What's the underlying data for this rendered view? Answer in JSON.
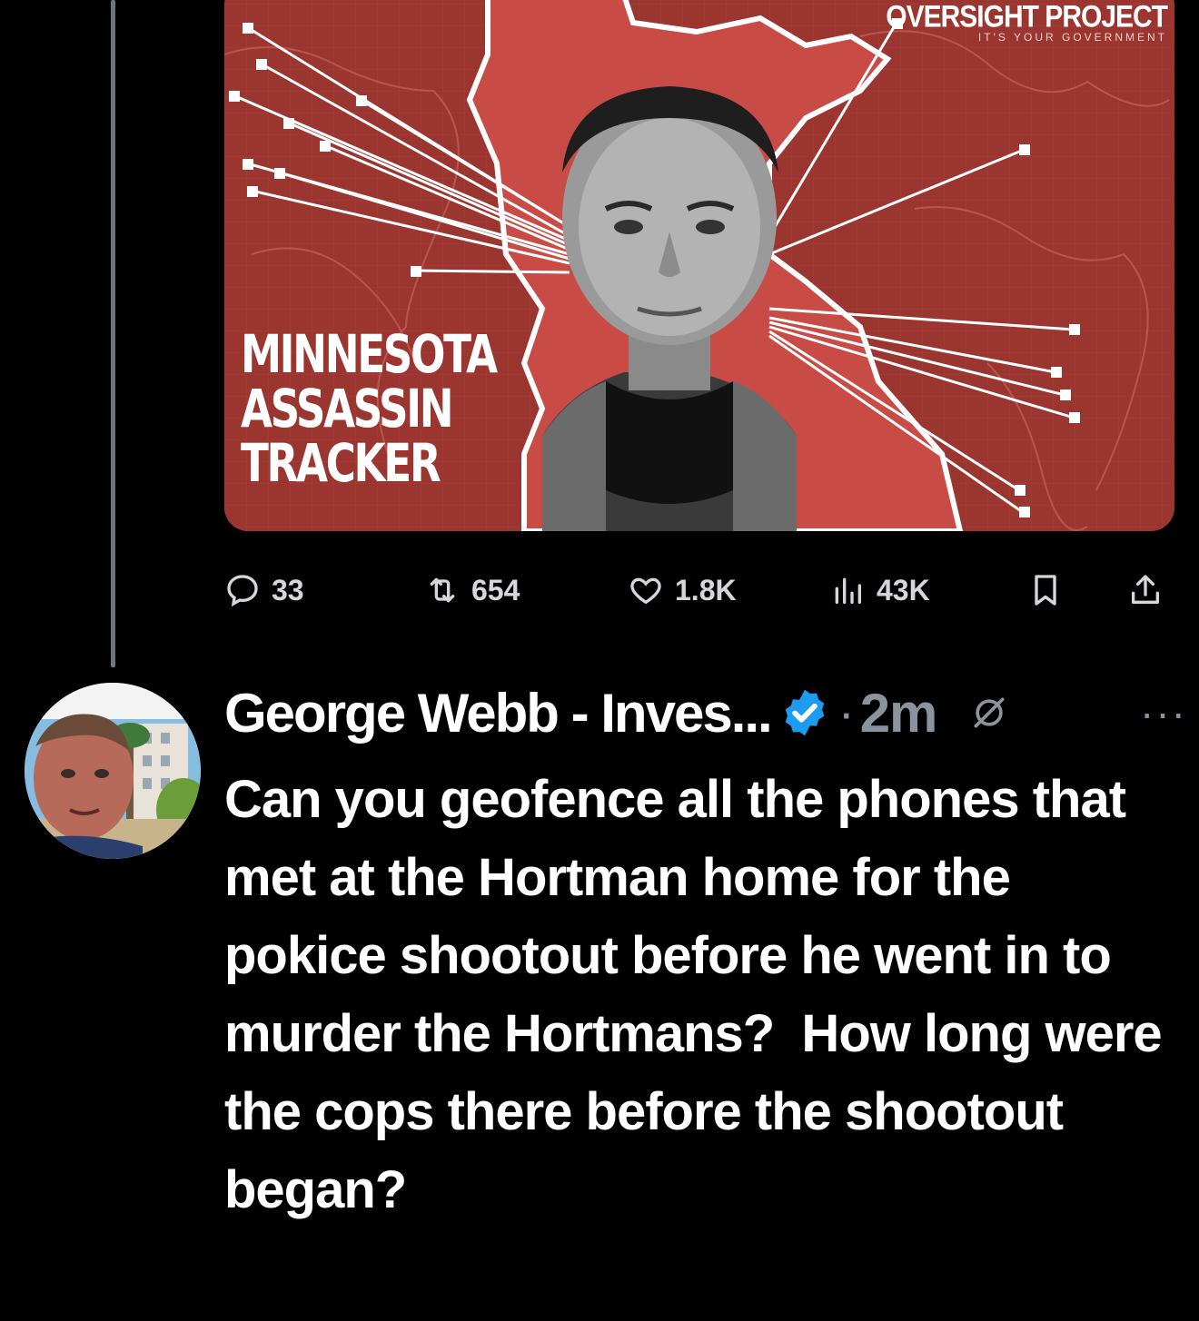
{
  "first_tweet": {
    "media": {
      "brand_name": "OVERSIGHT PROJECT",
      "brand_tagline": "IT'S YOUR GOVERNMENT",
      "title_lines": [
        "MINNESOTA",
        "ASSASSIN",
        "TRACKER"
      ],
      "colors": {
        "background": "#9b3530",
        "state": "#c94b45"
      }
    },
    "actions": {
      "replies": "33",
      "retweets": "654",
      "likes": "1.8K",
      "views": "43K"
    }
  },
  "reply_tweet": {
    "author_name": "George Webb - Inves...",
    "verified": true,
    "separator": "·",
    "time": "2m",
    "more": "···",
    "text": "Can you geofence all the phones that met at the Hortman home for the pokice shootout before he went in to murder the Hortmans?  How long were the cops there before the shootout began?"
  },
  "icons": [
    "reply-icon",
    "retweet-icon",
    "like-icon",
    "views-icon",
    "bookmark-icon",
    "share-icon",
    "verified-badge-icon",
    "muted-icon",
    "more-icon"
  ],
  "theme": {
    "background": "#000000",
    "text": "#e7e9ea",
    "secondary": "#8b949e",
    "verified": "#1d9bf0"
  }
}
